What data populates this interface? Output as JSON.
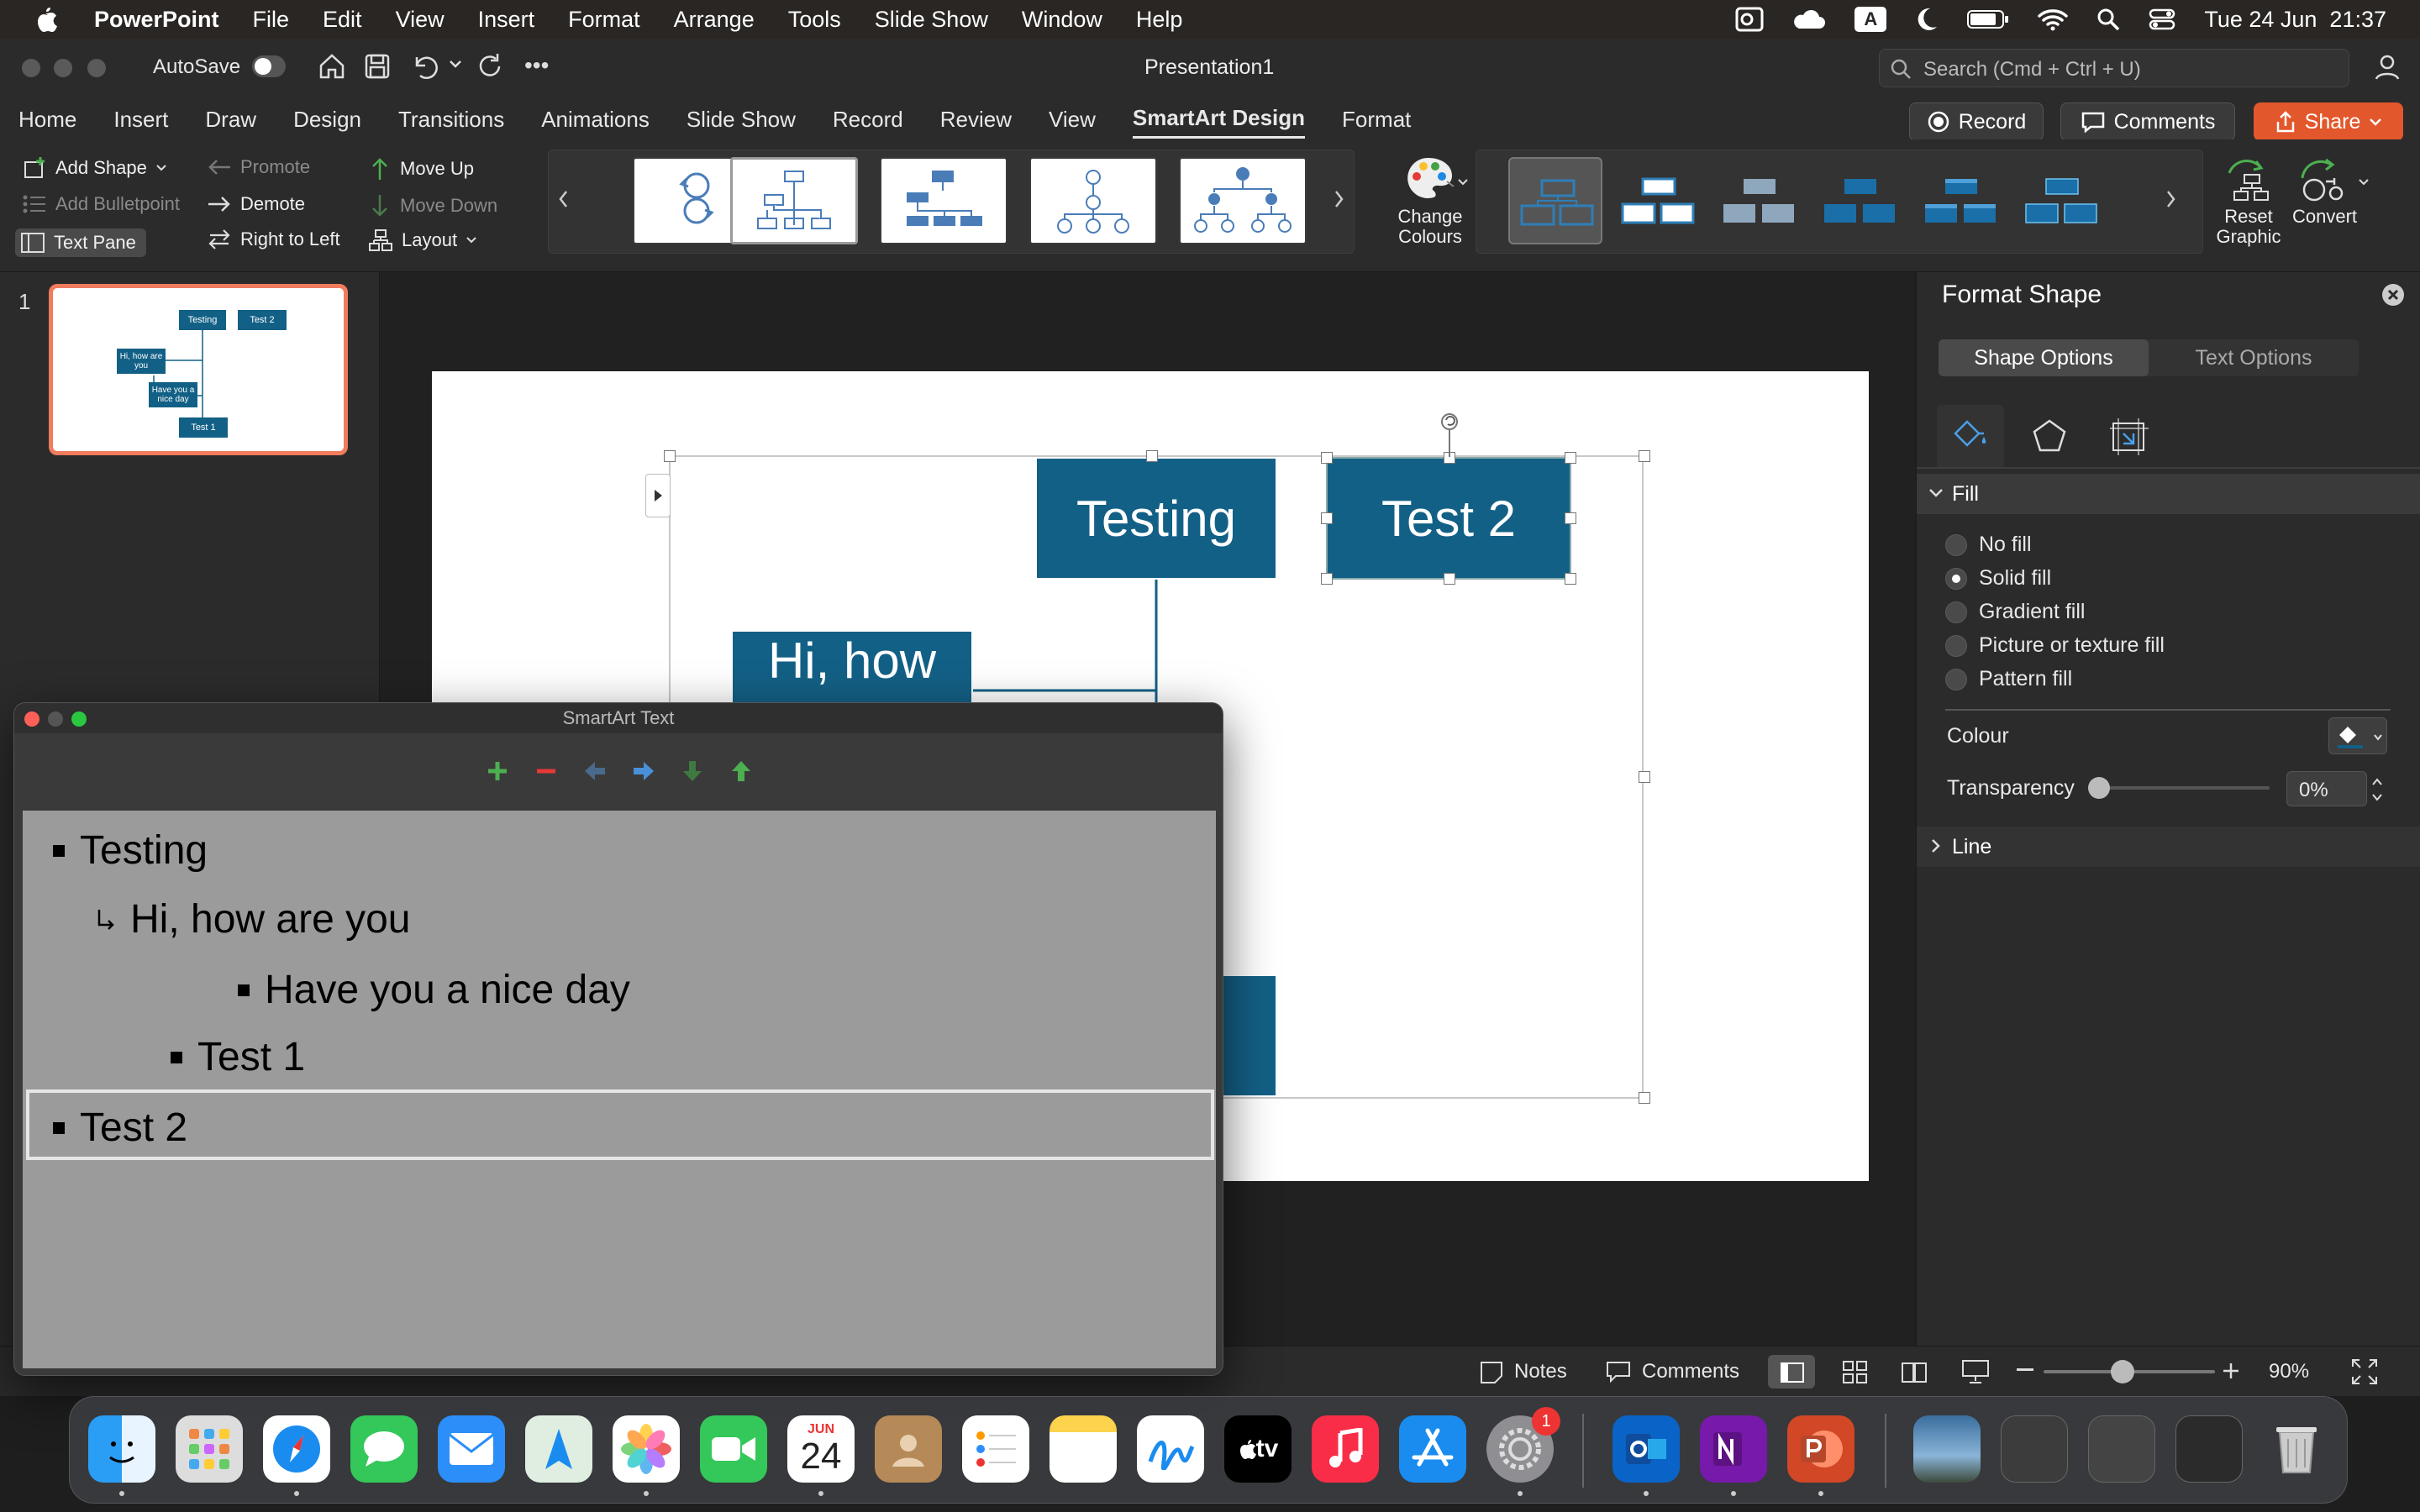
{
  "menubar": {
    "app_name": "PowerPoint",
    "items": [
      "File",
      "Edit",
      "View",
      "Insert",
      "Format",
      "Arrange",
      "Tools",
      "Slide Show",
      "Window",
      "Help"
    ],
    "input_indicator": "A",
    "datetime": "Tue 24 Jun  21:37"
  },
  "titlebar": {
    "autosave_label": "AutoSave",
    "doc_title": "Presentation1",
    "search_placeholder": "Search (Cmd + Ctrl + U)"
  },
  "tabs": [
    "Home",
    "Insert",
    "Draw",
    "Design",
    "Transitions",
    "Animations",
    "Slide Show",
    "Record",
    "Review",
    "View",
    "SmartArt Design",
    "Format"
  ],
  "active_tab": "SmartArt Design",
  "tab_buttons": {
    "record": "Record",
    "comments": "Comments",
    "share": "Share"
  },
  "ribbon": {
    "add_shape": "Add Shape",
    "add_bulletpoint": "Add Bulletpoint",
    "text_pane": "Text Pane",
    "promote": "Promote",
    "demote": "Demote",
    "right_to_left": "Right to Left",
    "move_up": "Move Up",
    "move_down": "Move Down",
    "layout": "Layout",
    "change_colours": "Change Colours",
    "reset_graphic": "Reset Graphic",
    "convert": "Convert"
  },
  "thumbnail": {
    "slide_number": "1",
    "texts": {
      "testing": "Testing",
      "test2": "Test 2",
      "hi": "Hi, how are you",
      "nice": "Have you a nice day",
      "test1": "Test 1"
    }
  },
  "slide": {
    "testing": "Testing",
    "test2": "Test 2",
    "hi_how": "Hi, how"
  },
  "format_pane": {
    "title": "Format Shape",
    "tabs": [
      "Shape Options",
      "Text Options"
    ],
    "fill_header": "Fill",
    "fill_options": [
      "No fill",
      "Solid fill",
      "Gradient fill",
      "Picture or texture fill",
      "Pattern fill"
    ],
    "selected_fill": "Solid fill",
    "colour_label": "Colour",
    "transparency_label": "Transparency",
    "transparency_value": "0%",
    "line_header": "Line"
  },
  "smartart_text": {
    "window_title": "SmartArt Text",
    "items": [
      {
        "text": "Testing",
        "level": 1
      },
      {
        "text": "Hi, how are you",
        "level": 2
      },
      {
        "text": "Have you a nice day",
        "level": 3
      },
      {
        "text": "Test 1",
        "level": 2
      },
      {
        "text": "Test 2",
        "level": 1
      }
    ],
    "selected_item": "Test 2"
  },
  "statusbar": {
    "notes": "Notes",
    "comments": "Comments",
    "zoom": "90%"
  },
  "dock": {
    "calendar_month": "JUN",
    "calendar_day": "24",
    "settings_badge": "1",
    "tv_label": "tv"
  },
  "colors": {
    "smartart_fill": "#136086",
    "share_button": "#e2572b",
    "thumbnail_selection": "#f07c5d"
  }
}
